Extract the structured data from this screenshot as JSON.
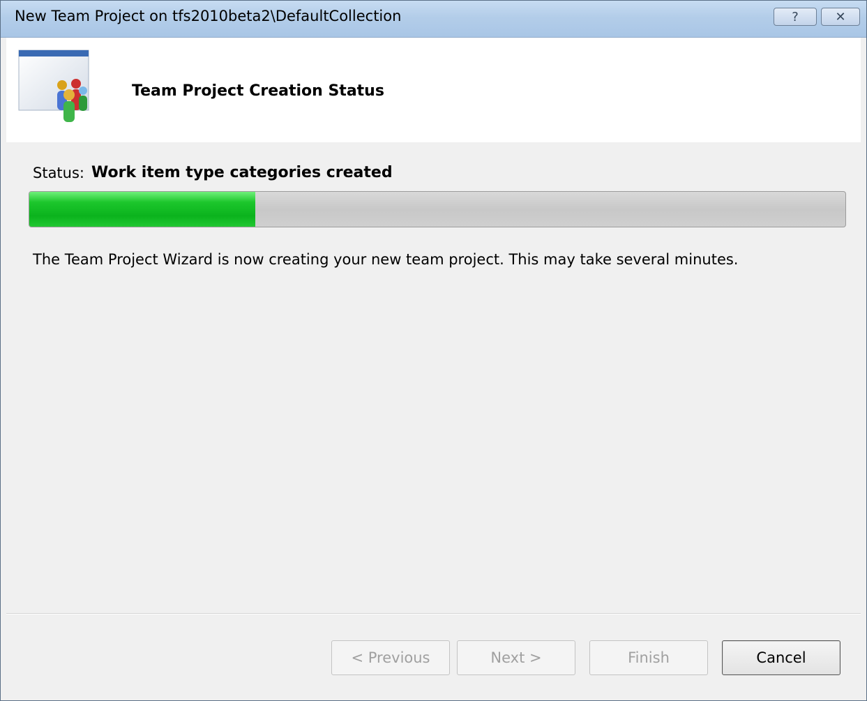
{
  "window": {
    "title": "New Team Project on tfs2010beta2\\DefaultCollection",
    "help_glyph": "?",
    "close_glyph": "✕"
  },
  "header": {
    "title": "Team Project Creation Status",
    "icon": "team-project-icon"
  },
  "status": {
    "label": "Status:",
    "value": "Work item type categories created",
    "progress_fraction": 0.277
  },
  "message": "The Team Project Wizard is now creating your new team project.  This may take several minutes.",
  "buttons": {
    "previous": "< Previous",
    "next": "Next >",
    "finish": "Finish",
    "cancel": "Cancel"
  },
  "colors": {
    "progress_fill": "#14bd26",
    "titlebar": "#b9d1ea"
  }
}
